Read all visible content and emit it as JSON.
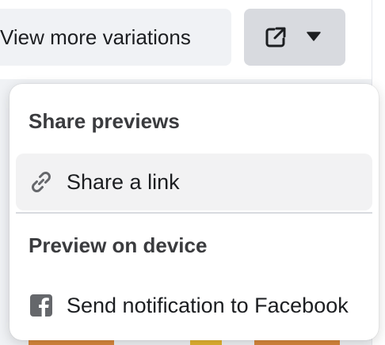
{
  "toolbar": {
    "view_variations_label": "View more variations"
  },
  "share_menu": {
    "sections": [
      {
        "title": "Share previews",
        "items": [
          {
            "label": "Share a link",
            "icon": "link-icon",
            "active": true
          }
        ]
      },
      {
        "title": "Preview on device",
        "items": [
          {
            "label": "Send notification to Facebook",
            "icon": "facebook-icon",
            "active": false
          }
        ]
      }
    ]
  },
  "colors": {
    "button_bg": "#f0f2f5",
    "button_active_bg": "#d8dadf",
    "menu_item_hover_bg": "#f2f2f3",
    "icon_gray": "#65676b",
    "thumbnail_orange": "#d9883c",
    "thumbnail_yellow": "#e5b431"
  }
}
